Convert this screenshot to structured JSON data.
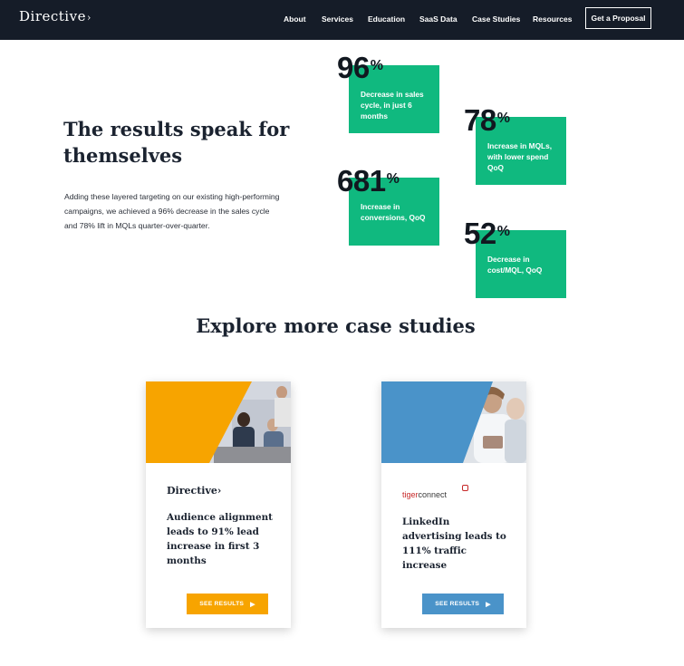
{
  "nav": {
    "logo": "Directive",
    "links": [
      "About",
      "Services",
      "Education",
      "SaaS Data",
      "Case Studies",
      "Resources"
    ],
    "cta": "Get a Proposal"
  },
  "results": {
    "headline": "The results speak for themselves",
    "intro": "Adding these layered targeting on our existing high-performing campaigns, we achieved a 96% decrease in the sales cycle and 78% lift in MQLs quarter-over-quarter.",
    "stats": [
      {
        "number": "96",
        "unit": "%",
        "label": "Decrease in sales cycle, in just 6 months"
      },
      {
        "number": "78",
        "unit": "%",
        "label": "Increase in MQLs, with lower spend QoQ"
      },
      {
        "number": "681",
        "unit": "%",
        "label": "Increase in conversions, QoQ"
      },
      {
        "number": "52",
        "unit": "%",
        "label": "Decrease in cost/MQL, QoQ"
      }
    ]
  },
  "explore": {
    "heading": "Explore more case studies",
    "cards": [
      {
        "logo": "Directive",
        "title": "Audience alignment leads to 91% lead increase in first 3 months",
        "button": "SEE RESULTS",
        "accent": "#f7a400"
      },
      {
        "logo_part1": "tiger",
        "logo_part2": "connect",
        "title": "LinkedIn advertising leads to 111% traffic increase",
        "button": "SEE RESULTS",
        "accent": "#4a93c9"
      }
    ]
  },
  "colors": {
    "nav_bg": "#151c28",
    "stat_green": "#10b97f"
  }
}
